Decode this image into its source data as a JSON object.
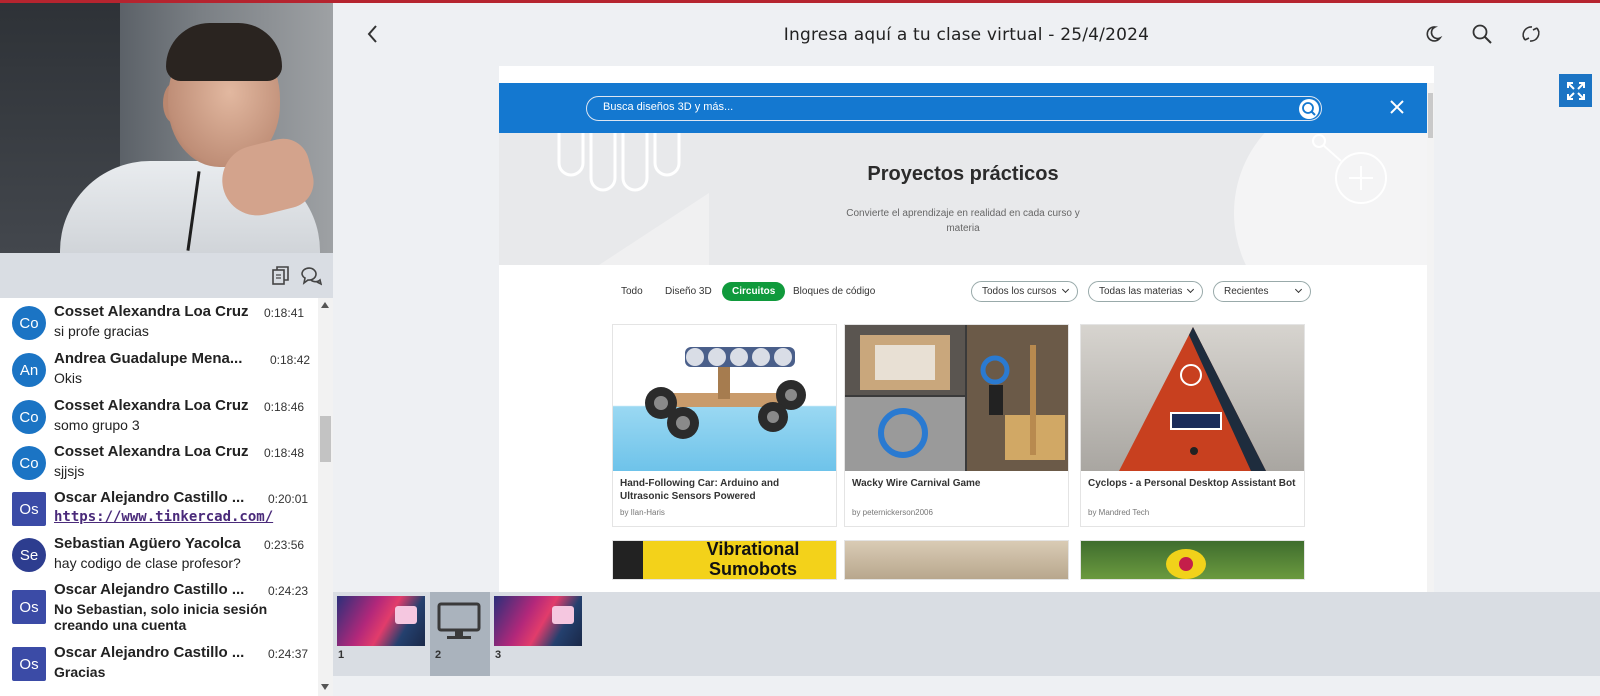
{
  "window": {
    "title": "Ingresa aquí a tu clase virtual - 25/4/2024"
  },
  "header": {
    "icons": [
      "back-icon",
      "dark-mode-icon",
      "search-icon",
      "sync-icon"
    ]
  },
  "chat": {
    "messages": [
      {
        "initials": "Co",
        "name": "Cosset Alexandra Loa Cruz",
        "time": "0:18:41",
        "text": "si profe gracias"
      },
      {
        "initials": "An",
        "name": "Andrea Guadalupe Mena...",
        "time": "0:18:42",
        "text": "Okis"
      },
      {
        "initials": "Co",
        "name": "Cosset Alexandra Loa Cruz",
        "time": "0:18:46",
        "text": "somo grupo 3"
      },
      {
        "initials": "Co",
        "name": "Cosset Alexandra Loa Cruz",
        "time": "0:18:48",
        "text": "sjjsjs"
      },
      {
        "initials": "Os",
        "name": "Oscar Alejandro Castillo ...",
        "time": "0:20:01",
        "text": "https://www.tinkercad.com/"
      },
      {
        "initials": "Se",
        "name": "Sebastian Agüero Yacolca",
        "time": "0:23:56",
        "text": "hay codigo de clase profesor?"
      },
      {
        "initials": "Os",
        "name": "Oscar Alejandro Castillo ...",
        "time": "0:24:23",
        "text": "No Sebastian, solo inicia sesión creando una cuenta"
      },
      {
        "initials": "Os",
        "name": "Oscar Alejandro Castillo ...",
        "time": "0:24:37",
        "text": "Gracias"
      }
    ]
  },
  "slide": {
    "search_placeholder": "Busca diseños 3D y más...",
    "hero_title": "Proyectos prácticos",
    "hero_subtitle": "Convierte el aprendizaje en realidad en cada curso y materia",
    "tabs": [
      "Todo",
      "Diseño 3D",
      "Circuitos",
      "Bloques de código"
    ],
    "active_tab": "Circuitos",
    "filters": [
      "Todos los cursos",
      "Todas las materias",
      "Recientes"
    ],
    "cards": [
      {
        "title": "Hand-Following Car: Arduino and Ultrasonic Sensors Powered",
        "author": "by Ilan-Haris"
      },
      {
        "title": "Wacky Wire Carnival Game",
        "author": "by peternickerson2006"
      },
      {
        "title": "Cyclops - a Personal Desktop Assistant Bot",
        "author": "by Mandred Tech"
      }
    ],
    "partial_card_text": "Vibrational Sumobots"
  },
  "thumbnails": [
    {
      "number": "1"
    },
    {
      "number": "2"
    },
    {
      "number": "3"
    }
  ],
  "colors": {
    "accent_red": "#b5242f",
    "avatar_blue": "#1b74c4",
    "tinkercad_blue": "#1478d0",
    "active_tab_green": "#109a3c"
  }
}
